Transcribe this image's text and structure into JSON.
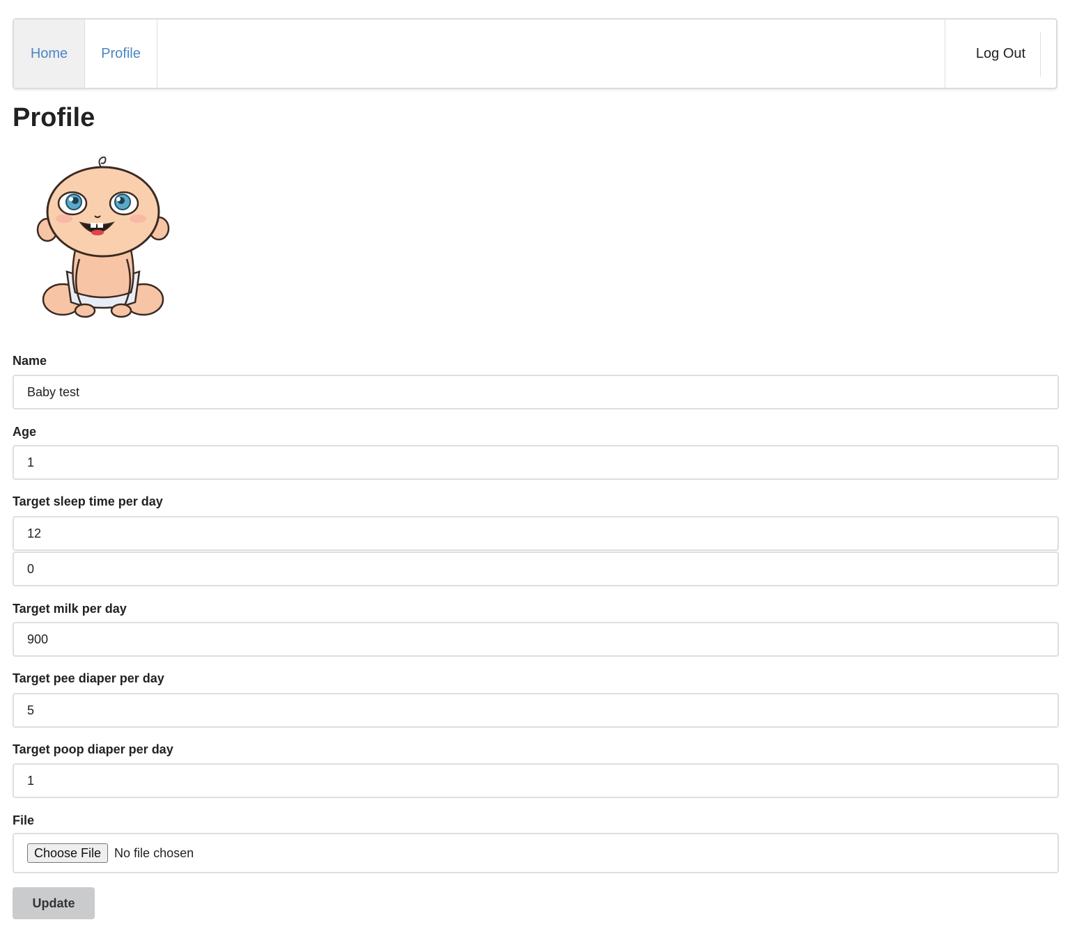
{
  "nav": {
    "home_label": "Home",
    "profile_label": "Profile",
    "logout_label": "Log Out"
  },
  "page": {
    "title": "Profile"
  },
  "avatar": {
    "icon": "baby-avatar"
  },
  "form": {
    "name_label": "Name",
    "name_value": "Baby test",
    "age_label": "Age",
    "age_value": "1",
    "sleep_label": "Target sleep time per day",
    "sleep_hours_value": "12",
    "sleep_minutes_value": "0",
    "milk_label": "Target milk per day",
    "milk_value": "900",
    "pee_label": "Target pee diaper per day",
    "pee_value": "5",
    "poop_label": "Target poop diaper per day",
    "poop_value": "1",
    "file_label": "File",
    "file_button_label": "Choose File",
    "file_status": "No file chosen",
    "update_label": "Update"
  },
  "colors": {
    "link": "#4a86c5",
    "nav_active_bg": "#f0f0f0",
    "button_bg": "#cacbcd"
  }
}
